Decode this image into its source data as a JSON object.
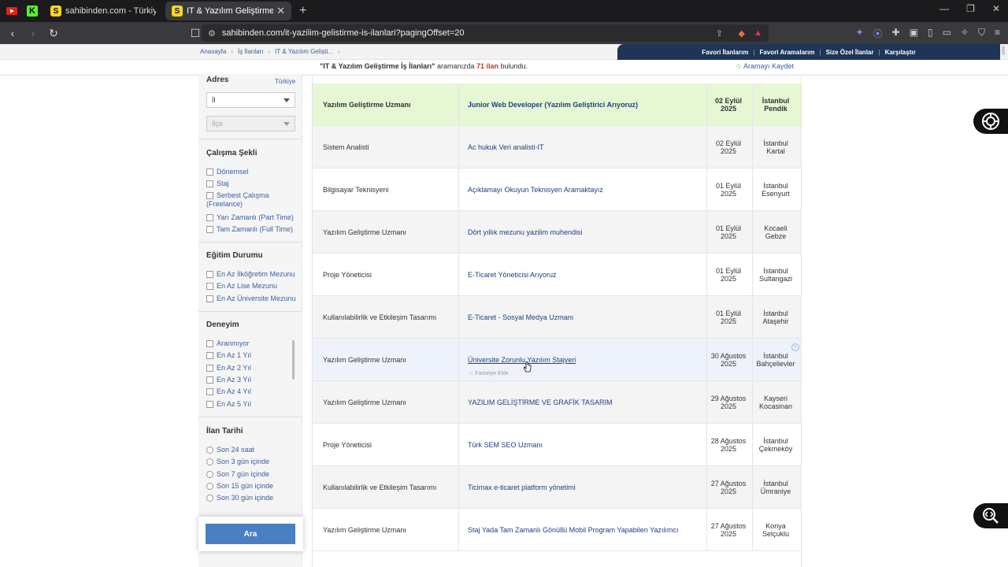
{
  "browser": {
    "pinned": [
      {
        "label": "",
        "icon": "youtube-icon"
      },
      {
        "label": "K",
        "icon": "k-icon"
      }
    ],
    "tabs": [
      {
        "favicon": "S",
        "title": "sahibinden.com - Türkiye'nin Onl",
        "active": false
      },
      {
        "favicon": "S",
        "title": "IT & Yazılım Geliştirme İş İlanları",
        "active": true
      }
    ],
    "url": "sahibinden.com/it-yazilim-gelistirme-is-ilanlari?pagingOffset=20"
  },
  "breadcrumb": [
    "Anasayfa",
    "İş İlanları",
    "IT & Yazılım Geliști..."
  ],
  "topnav": [
    "Favori İlanlarım",
    "Favori Aramalarım",
    "Size Özel İlanlar",
    "Karşılaştır"
  ],
  "results": {
    "query": "\"IT & Yazılım Geliştirme İş İlanları\"",
    "mid": " aramanızda ",
    "count": "71 ilan",
    "tail": " bulundu.",
    "save_label": "Aramayı Kaydet"
  },
  "sidebar": {
    "address": {
      "title": "Adres",
      "country": "Türkiye",
      "city_placeholder": "İl",
      "district_placeholder": "İlçe"
    },
    "work_type": {
      "title": "Çalışma Şekli",
      "options": [
        "Dönemsel",
        "Staj",
        "Serbest Çalışma (Freelance)",
        "Yarı Zamanlı (Part Time)",
        "Tam Zamanlı (Full Time)"
      ]
    },
    "education": {
      "title": "Eğitim Durumu",
      "options": [
        "En Az İlköğretim Mezunu",
        "En Az Lise Mezunu",
        "En Az Üniversite Mezunu"
      ]
    },
    "experience": {
      "title": "Deneyim",
      "options": [
        "Aranmıyor",
        "En Az 1 Yıl",
        "En Az 2 Yıl",
        "En Az 3 Yıl",
        "En Az 4 Yıl",
        "En Az 5 Yıl"
      ]
    },
    "date": {
      "title": "İlan Tarihi",
      "options": [
        "Son 24 saat",
        "Son 3 gün içinde",
        "Son 7 gün içinde",
        "Son 15 gün içinde",
        "Son 30 gün içinde"
      ]
    },
    "search_button": "Ara"
  },
  "listings": [
    {
      "category": "Yazılım Geliştirme Uzmanı",
      "title": "Junior Web Developer (Yazılım Geliştirici Arıyoruz)",
      "date": "02 Eylül 2025",
      "city": "İstanbul",
      "district": "Pendik",
      "style": "featured"
    },
    {
      "category": "Sistem Analisti",
      "title": "Ac hukuk Veri analisti-IT",
      "date": "02 Eylül 2025",
      "city": "İstanbul",
      "district": "Kartal",
      "style": "alt"
    },
    {
      "category": "Bilgisayar Teknisyeni",
      "title": "Açıklamayı Okuyun Teknisyen Aramaktayız",
      "date": "01 Eylül 2025",
      "city": "İstanbul",
      "district": "Esenyurt",
      "style": "plain"
    },
    {
      "category": "Yazılım Geliştirme Uzmanı",
      "title": "Dört yıllık mezunu yazilim muhendisi",
      "date": "01 Eylül 2025",
      "city": "Kocaeli",
      "district": "Gebze",
      "style": "alt"
    },
    {
      "category": "Proje Yöneticisi",
      "title": "E-Ticaret Yöneticisi Arıyoruz",
      "date": "01 Eylül 2025",
      "city": "İstanbul",
      "district": "Sultangazi",
      "style": "plain"
    },
    {
      "category": "Kullanılabilirlik ve Etkileşim Tasarımı",
      "title": "E-Ticaret - Sosyal Medya Uzmanı",
      "date": "01 Eylül 2025",
      "city": "İstanbul",
      "district": "Ataşehir",
      "style": "alt"
    },
    {
      "category": "Yazılım Geliştirme Uzmanı",
      "title": "Üniversite Zorunlu Yazılım Stajyeri",
      "date": "30 Ağustos 2025",
      "city": "İstanbul",
      "district": "Bahçelievler",
      "style": "hover",
      "fav": "Favoriye Ekle"
    },
    {
      "category": "Yazılım Geliştirme Uzmanı",
      "title": "YAZILIM GELİŞTİRME VE GRAFİK TASARIM",
      "date": "29 Ağustos 2025",
      "city": "Kayseri",
      "district": "Kocasinan",
      "style": "alt"
    },
    {
      "category": "Proje Yöneticisi",
      "title": "Türk SEM SEO Uzmanı",
      "date": "28 Ağustos 2025",
      "city": "İstanbul",
      "district": "Çekmeköy",
      "style": "plain"
    },
    {
      "category": "Kullanılabilirlik ve Etkileşim Tasarımı",
      "title": "Ticimax e-ticaret platform yönetimi",
      "date": "27 Ağustos 2025",
      "city": "İstanbul",
      "district": "Ümraniye",
      "style": "alt"
    },
    {
      "category": "Yazılım Geliştirme Uzmanı",
      "title": "Staj Yada Tam Zamanlı Gönüllü Mobil Program Yapabilen Yazılımcı",
      "date": "27 Ağustos 2025",
      "city": "Konya",
      "district": "Selçuklu",
      "style": "plain"
    }
  ],
  "colors": {
    "brand_navy": "#1f3557",
    "link": "#1f3f7a",
    "featured": "#e6f7d4",
    "button": "#4a7fc1"
  }
}
